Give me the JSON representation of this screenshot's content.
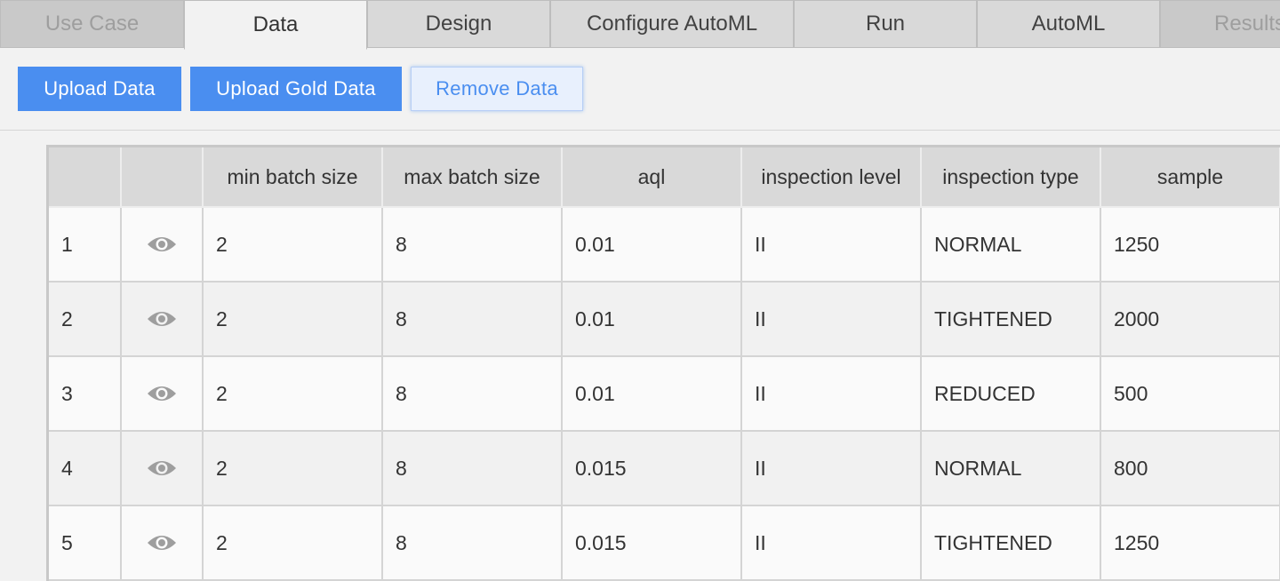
{
  "tabs": [
    {
      "label": "Use Case",
      "state": "disabled"
    },
    {
      "label": "Data",
      "state": "active"
    },
    {
      "label": "Design",
      "state": "normal"
    },
    {
      "label": "Configure AutoML",
      "state": "normal"
    },
    {
      "label": "Run",
      "state": "normal"
    },
    {
      "label": "AutoML",
      "state": "normal"
    },
    {
      "label": "Results",
      "state": "disabled"
    }
  ],
  "toolbar": {
    "upload_label": "Upload Data",
    "upload_gold_label": "Upload Gold Data",
    "remove_label": "Remove Data"
  },
  "table": {
    "columns": [
      "",
      "",
      "min batch size",
      "max batch size",
      "aql",
      "inspection level",
      "inspection type",
      "sample",
      ""
    ],
    "rows": [
      {
        "index": "1",
        "min_batch": "2",
        "max_batch": "8",
        "aql": "0.01",
        "level": "II",
        "type": "NORMAL",
        "sample": "1250"
      },
      {
        "index": "2",
        "min_batch": "2",
        "max_batch": "8",
        "aql": "0.01",
        "level": "II",
        "type": "TIGHTENED",
        "sample": "2000"
      },
      {
        "index": "3",
        "min_batch": "2",
        "max_batch": "8",
        "aql": "0.01",
        "level": "II",
        "type": "REDUCED",
        "sample": "500"
      },
      {
        "index": "4",
        "min_batch": "2",
        "max_batch": "8",
        "aql": "0.015",
        "level": "II",
        "type": "NORMAL",
        "sample": "800"
      },
      {
        "index": "5",
        "min_batch": "2",
        "max_batch": "8",
        "aql": "0.015",
        "level": "II",
        "type": "TIGHTENED",
        "sample": "1250"
      }
    ]
  },
  "icons": {
    "row_view": "eye-icon"
  },
  "colors": {
    "primary": "#4a8ef0",
    "tab_bg": "#d9d9d9",
    "header_bg": "#d9d9d9"
  }
}
